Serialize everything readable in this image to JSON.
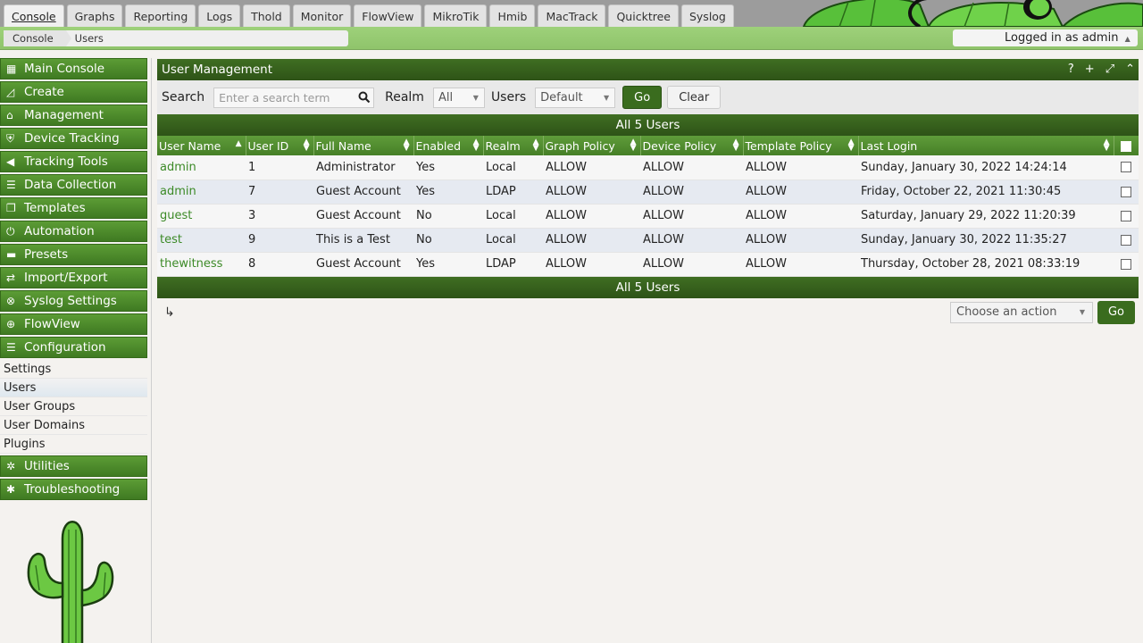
{
  "tabs": [
    "Console",
    "Graphs",
    "Reporting",
    "Logs",
    "Thold",
    "Monitor",
    "FlowView",
    "MikroTik",
    "Hmib",
    "MacTrack",
    "Quicktree",
    "Syslog"
  ],
  "breadcrumb": [
    "Console",
    "Users"
  ],
  "login": {
    "text": "Logged in as admin",
    "caret": "▲"
  },
  "nav": [
    {
      "label": "Main Console",
      "icon": "map-icon",
      "glyph": "▦"
    },
    {
      "label": "Create",
      "icon": "chart-icon",
      "glyph": "◿"
    },
    {
      "label": "Management",
      "icon": "home-icon",
      "glyph": "⌂"
    },
    {
      "label": "Device Tracking",
      "icon": "shield-icon",
      "glyph": "⛨"
    },
    {
      "label": "Tracking Tools",
      "icon": "bullhorn-icon",
      "glyph": "◀"
    },
    {
      "label": "Data Collection",
      "icon": "database-icon",
      "glyph": "☰"
    },
    {
      "label": "Templates",
      "icon": "copy-icon",
      "glyph": "❐"
    },
    {
      "label": "Automation",
      "icon": "power-icon",
      "glyph": "⏻"
    },
    {
      "label": "Presets",
      "icon": "archive-icon",
      "glyph": "▬"
    },
    {
      "label": "Import/Export",
      "icon": "exchange-icon",
      "glyph": "⇄"
    },
    {
      "label": "Syslog Settings",
      "icon": "cancel-icon",
      "glyph": "⊗"
    },
    {
      "label": "FlowView",
      "icon": "crosshair-icon",
      "glyph": "⊕"
    },
    {
      "label": "Configuration",
      "icon": "sliders-icon",
      "glyph": "☰"
    }
  ],
  "subnav": [
    {
      "label": "Settings",
      "selected": false
    },
    {
      "label": "Users",
      "selected": true
    },
    {
      "label": "User Groups",
      "selected": false
    },
    {
      "label": "User Domains",
      "selected": false
    },
    {
      "label": "Plugins",
      "selected": false
    }
  ],
  "nav2": [
    {
      "label": "Utilities",
      "icon": "cogs-icon",
      "glyph": "✲"
    },
    {
      "label": "Troubleshooting",
      "icon": "bug-icon",
      "glyph": "✱"
    }
  ],
  "panel": {
    "title": "User Management",
    "icons": {
      "help": "?",
      "add": "+",
      "expand": "⤢",
      "collapse": "⌃"
    }
  },
  "filter": {
    "search_label": "Search",
    "search_placeholder": "Enter a search term",
    "realm_label": "Realm",
    "realm_value": "All",
    "users_label": "Users",
    "users_value": "Default",
    "go": "Go",
    "clear": "Clear"
  },
  "summary": "All 5 Users",
  "table": {
    "columns": [
      "User Name",
      "User ID",
      "Full Name",
      "Enabled",
      "Realm",
      "Graph Policy",
      "Device Policy",
      "Template Policy",
      "Last Login"
    ],
    "rows": [
      [
        "admin",
        "1",
        "Administrator",
        "Yes",
        "Local",
        "ALLOW",
        "ALLOW",
        "ALLOW",
        "Sunday, January 30, 2022 14:24:14"
      ],
      [
        "admin",
        "7",
        "Guest Account",
        "Yes",
        "LDAP",
        "ALLOW",
        "ALLOW",
        "ALLOW",
        "Friday, October 22, 2021 11:30:45"
      ],
      [
        "guest",
        "3",
        "Guest Account",
        "No",
        "Local",
        "ALLOW",
        "ALLOW",
        "ALLOW",
        "Saturday, January 29, 2022 11:20:39"
      ],
      [
        "test",
        "9",
        "This is a Test",
        "No",
        "Local",
        "ALLOW",
        "ALLOW",
        "ALLOW",
        "Sunday, January 30, 2022 11:35:27"
      ],
      [
        "thewitness",
        "8",
        "Guest Account",
        "Yes",
        "LDAP",
        "ALLOW",
        "ALLOW",
        "ALLOW",
        "Thursday, October 28, 2021 08:33:19"
      ]
    ]
  },
  "actions": {
    "placeholder": "Choose an action",
    "go": "Go"
  }
}
